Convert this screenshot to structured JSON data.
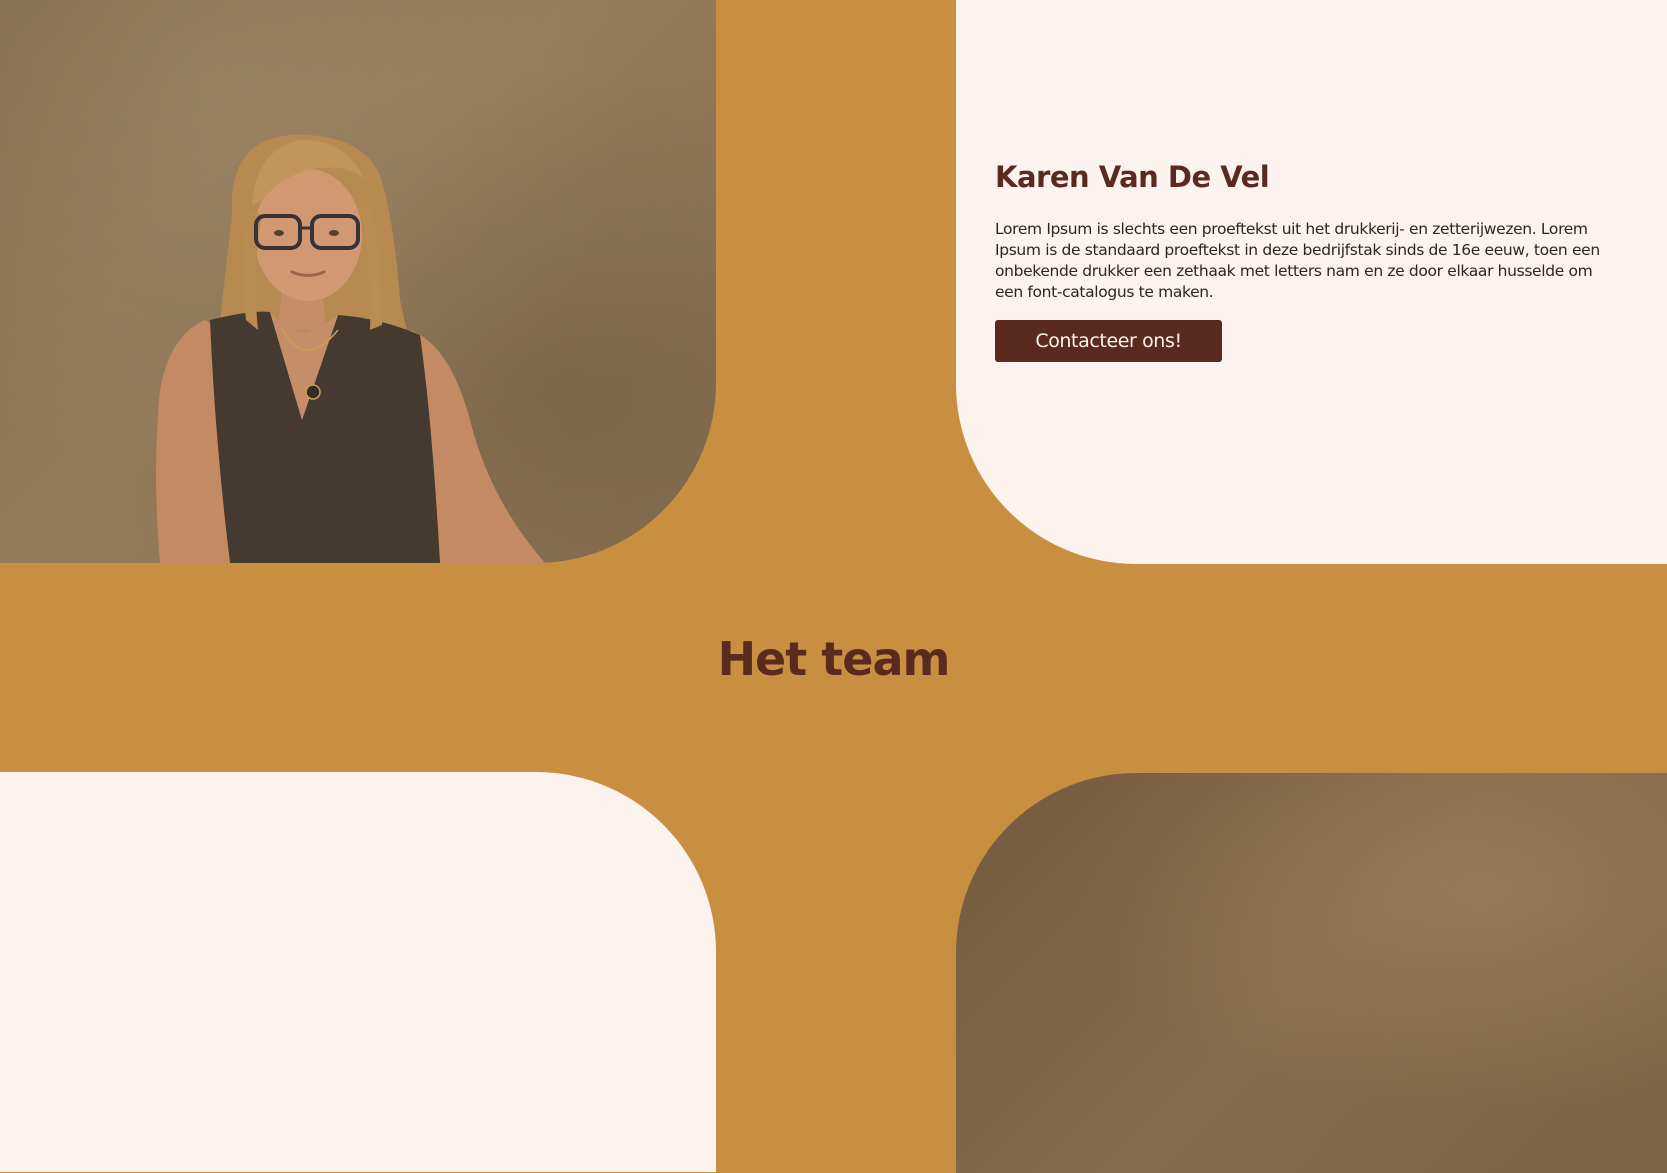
{
  "profile": {
    "name": "Karen Van De Vel",
    "bio": "Lorem Ipsum is slechts een proeftekst uit het drukkerij- en zetterijwezen. Lorem Ipsum is de standaard proeftekst in deze bedrijfstak sinds de 16e eeuw, toen een onbekende drukker een zethaak met letters nam en ze door elkaar husselde om een font-catalogus te maken.",
    "contact_button_label": "Contacteer ons!"
  },
  "team_section": {
    "title": "Het team"
  },
  "colors": {
    "page_background": "#c98f40",
    "card_background": "#fdf3ee",
    "accent": "#5b2a1e",
    "body_text": "#2b2523"
  }
}
